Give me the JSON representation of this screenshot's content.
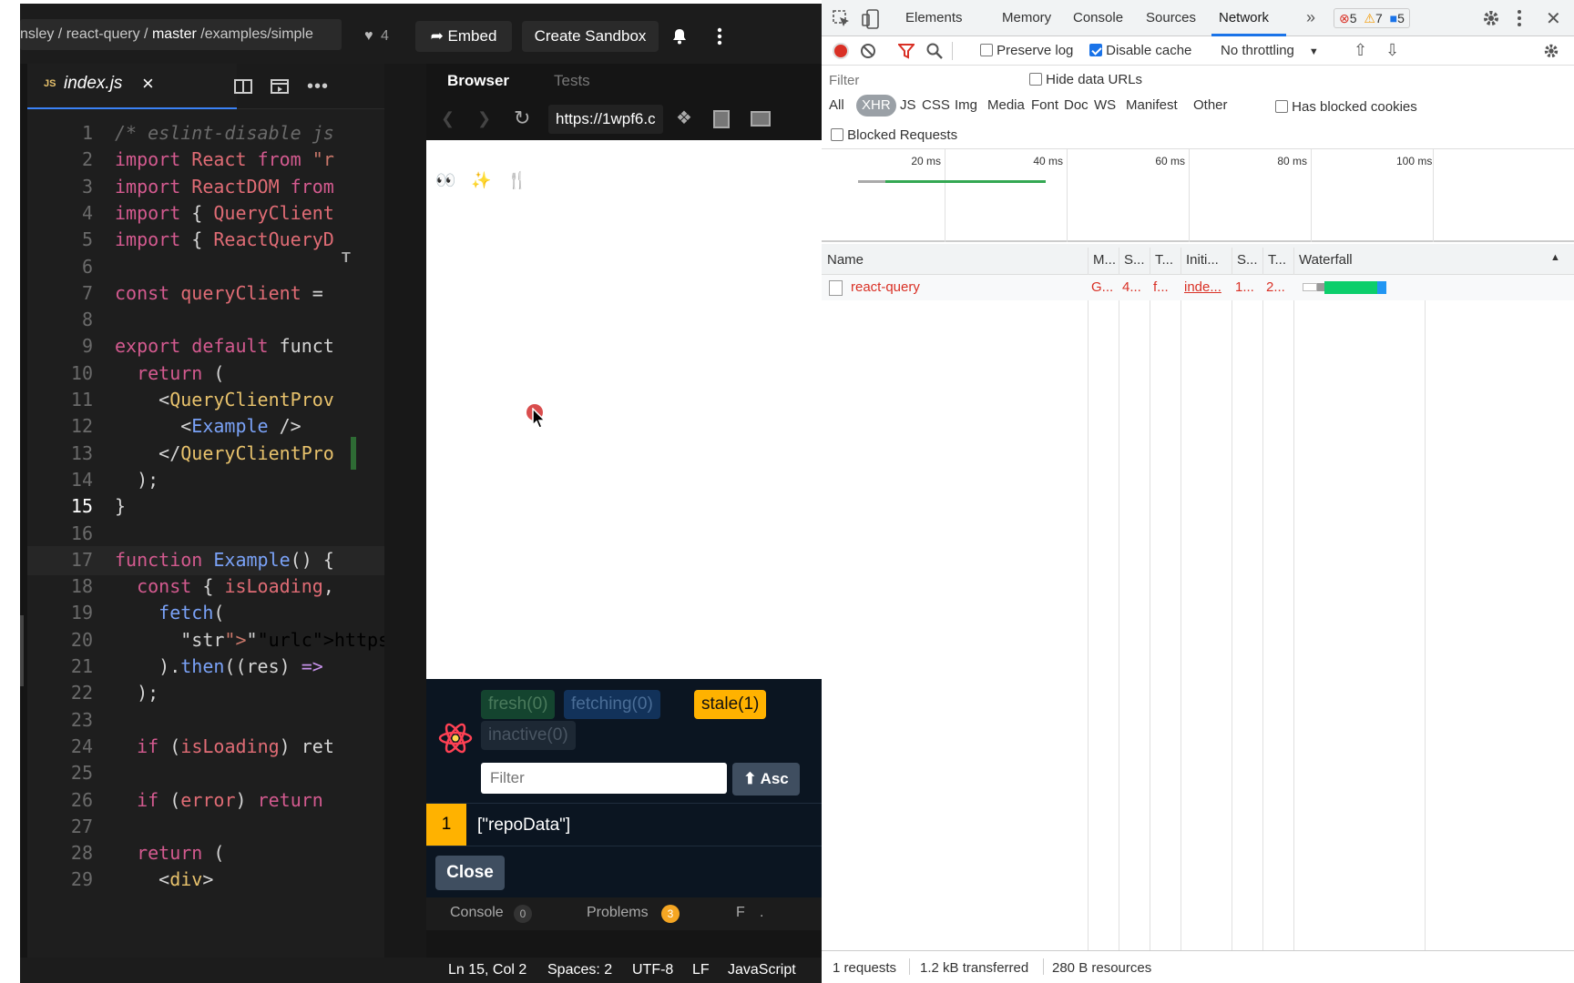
{
  "codesandbox": {
    "breadcrumb": {
      "prefix": "nsley / react-query / ",
      "branch": "master",
      "path": " /examples/simple"
    },
    "likes": "4",
    "embed_label": "Embed",
    "create_sandbox_label": "Create Sandbox",
    "editor": {
      "tab_badge": "JS",
      "tab_name": "index.js",
      "current_line": 15,
      "lines": [
        {
          "n": "1",
          "t": "/* eslint-disable js"
        },
        {
          "n": "2",
          "t": "import React from \"r"
        },
        {
          "n": "3",
          "t": "import ReactDOM from"
        },
        {
          "n": "4",
          "t": "import { QueryClient"
        },
        {
          "n": "5",
          "t": "import { ReactQueryD"
        },
        {
          "n": "6",
          "t": ""
        },
        {
          "n": "7",
          "t": "const queryClient = "
        },
        {
          "n": "8",
          "t": ""
        },
        {
          "n": "9",
          "t": "export default funct"
        },
        {
          "n": "10",
          "t": "  return ("
        },
        {
          "n": "11",
          "t": "    <QueryClientProv"
        },
        {
          "n": "12",
          "t": "      <Example />"
        },
        {
          "n": "13",
          "t": "    </QueryClientPro"
        },
        {
          "n": "14",
          "t": "  );"
        },
        {
          "n": "15",
          "t": "}"
        },
        {
          "n": "16",
          "t": ""
        },
        {
          "n": "17",
          "t": "function Example() {"
        },
        {
          "n": "18",
          "t": "  const { isLoading,"
        },
        {
          "n": "19",
          "t": "    fetch("
        },
        {
          "n": "20",
          "t": "      \"https://api.g"
        },
        {
          "n": "21",
          "t": "    ).then((res) =>"
        },
        {
          "n": "22",
          "t": "  );"
        },
        {
          "n": "23",
          "t": ""
        },
        {
          "n": "24",
          "t": "  if (isLoading) ret"
        },
        {
          "n": "25",
          "t": ""
        },
        {
          "n": "26",
          "t": "  if (error) return"
        },
        {
          "n": "27",
          "t": ""
        },
        {
          "n": "28",
          "t": "  return ("
        },
        {
          "n": "29",
          "t": "    <div>"
        }
      ]
    },
    "browser": {
      "tab_browser": "Browser",
      "tab_tests": "Tests",
      "url": "https://1wpf6.c",
      "content_emojis": "👀 ✨ 🍴"
    },
    "rq_devtools": {
      "fresh": "fresh(0)",
      "fetching": "fetching(0)",
      "stale": "stale(1)",
      "inactive": "inactive(0)",
      "filter_placeholder": "Filter",
      "sort_label": "⬆ Asc",
      "query_count": "1",
      "query_key": "[\"repoData\"]",
      "close_label": "Close"
    },
    "bottom_tabs": {
      "console": "Console",
      "console_count": "0",
      "problems": "Problems",
      "problems_count": "3",
      "more": "F"
    },
    "status": {
      "position": "Ln 15, Col 2",
      "spaces": "Spaces: 2",
      "encoding": "UTF-8",
      "eol": "LF",
      "language": "JavaScript"
    }
  },
  "devtools": {
    "tabs": [
      "Elements",
      "Memory",
      "Console",
      "Sources",
      "Network"
    ],
    "active_tab": "Network",
    "errors": "5",
    "warnings": "7",
    "messages": "5",
    "toolbar": {
      "preserve_log": "Preserve log",
      "disable_cache": "Disable cache",
      "throttling": "No throttling"
    },
    "filter_placeholder": "Filter",
    "hide_data_urls": "Hide data URLs",
    "type_filters": [
      "All",
      "XHR",
      "JS",
      "CSS",
      "Img",
      "Media",
      "Font",
      "Doc",
      "WS",
      "Manifest",
      "Other"
    ],
    "active_type": "XHR",
    "has_blocked_cookies": "Has blocked cookies",
    "blocked_requests": "Blocked Requests",
    "timeline_ticks": [
      "20 ms",
      "40 ms",
      "60 ms",
      "80 ms",
      "100 ms"
    ],
    "columns": {
      "name": "Name",
      "method": "M...",
      "status": "S...",
      "type": "T...",
      "initiator": "Initi...",
      "size": "S...",
      "time": "T...",
      "waterfall": "Waterfall"
    },
    "row": {
      "name": "react-query",
      "method": "G...",
      "status": "4...",
      "type": "f...",
      "initiator": "inde...",
      "size": "1...",
      "time": "2..."
    },
    "summary": {
      "requests": "1 requests",
      "transferred": "1.2 kB transferred",
      "resources": "280 B resources"
    }
  },
  "colors": {
    "accent": "#1a73e8",
    "error": "#d93025",
    "stale": "#ffb200",
    "rq_bg": "#0b1521"
  }
}
